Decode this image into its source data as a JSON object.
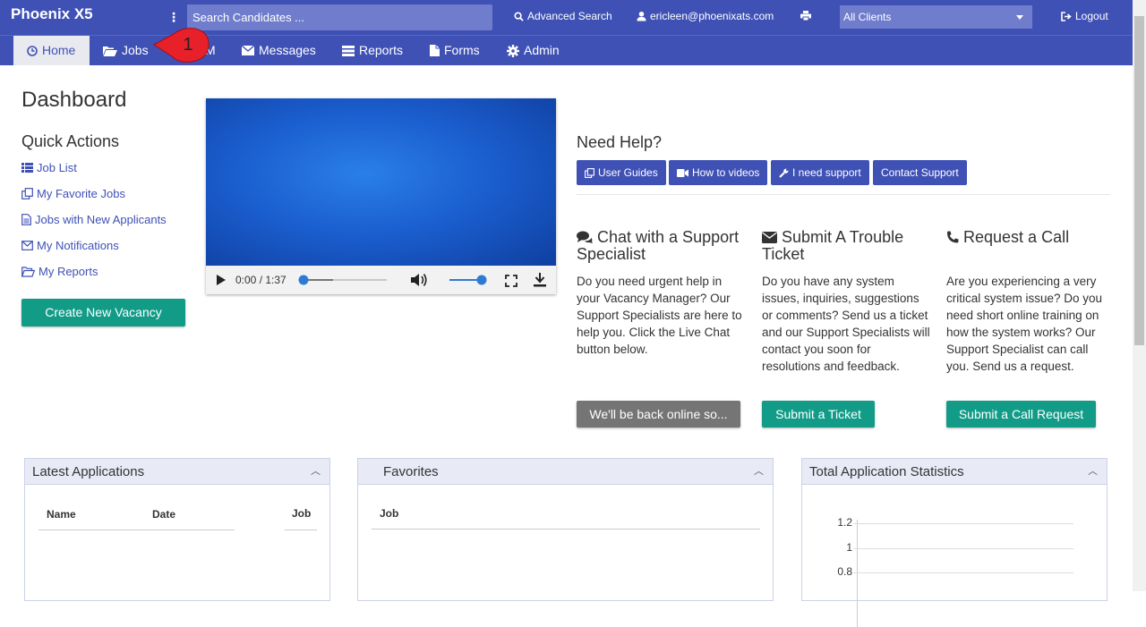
{
  "topbar": {
    "brand": "Phoenix X5",
    "search_placeholder": "Search Candidates ...",
    "advanced_search": "Advanced Search",
    "user_email": "ericleen@phoenixats.com",
    "client_select": "All Clients",
    "logout": "Logout"
  },
  "nav": {
    "home": "Home",
    "jobs": "Jobs",
    "crm_partial": "M",
    "messages": "Messages",
    "reports": "Reports",
    "forms": "Forms",
    "admin": "Admin",
    "annotation_number": "1"
  },
  "dashboard": {
    "title": "Dashboard",
    "quick_actions_title": "Quick Actions",
    "quick_actions": [
      "Job List",
      "My Favorite Jobs",
      "Jobs with New Applicants",
      "My Notifications",
      "My Reports"
    ],
    "create_button": "Create New Vacancy"
  },
  "video": {
    "time": "0:00 / 1:37",
    "progress": 0.0
  },
  "help": {
    "title": "Need Help?",
    "buttons": [
      "User Guides",
      "How to videos",
      "I need support",
      "Contact Support"
    ]
  },
  "support": {
    "chat": {
      "title": "Chat with a Support Specialist",
      "body": "Do you need urgent help in your Vacancy Manager? Our Support Specialists are here to help you. Click the Live Chat button below.",
      "button": "We'll be back online so..."
    },
    "ticket": {
      "title": "Submit A Trouble Ticket",
      "body": "Do you have any system issues, inquiries, suggestions or comments? Send us a ticket and our Support Specialists will contact you soon for resolutions and feedback.",
      "button": "Submit a Ticket"
    },
    "call": {
      "title": "Request a Call",
      "body": "Are you experiencing a very critical system issue? Do you need short online training on how the system works? Our Support Specialist can call you. Send us a request.",
      "button": "Submit a Call Request"
    }
  },
  "panels": {
    "latest": {
      "title": "Latest Applications",
      "cols": [
        "Name",
        "Date",
        "Job"
      ]
    },
    "favorites": {
      "title": "Favorites",
      "cols": [
        "Job"
      ]
    },
    "stats": {
      "title": "Total Application Statistics"
    }
  },
  "chart_data": {
    "type": "bar",
    "title": "",
    "y_ticks": [
      "1.2",
      "1",
      "0.8"
    ],
    "ylim": [
      0.8,
      1.2
    ],
    "categories": [],
    "values": []
  },
  "colors": {
    "primary": "#3f51b5",
    "teal": "#129c88",
    "gray_button": "#757575",
    "annotation": "#e8202a"
  }
}
